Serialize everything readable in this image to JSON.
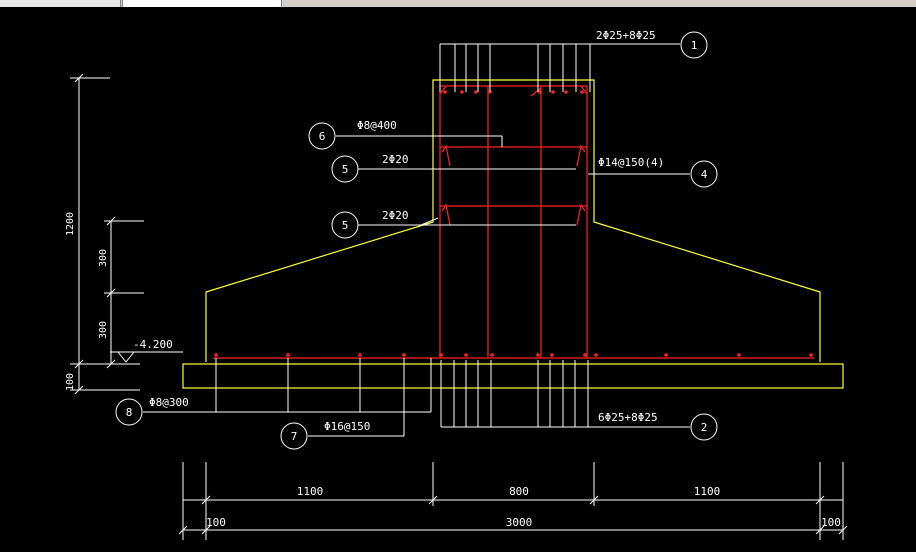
{
  "window": {
    "title": ""
  },
  "drawing": {
    "labels": {
      "top_bars": "2Φ25+8Φ25",
      "bottom_bars": "6Φ25+8Φ25",
      "tie_bar": "Φ8@400",
      "waist_bars_upper": "2Φ20",
      "waist_bars_lower": "2Φ20",
      "stirrup": "Φ14@150(4)",
      "mesh_y": "Φ16@150",
      "mesh_x": "Φ8@300",
      "elevation": "-4.200"
    },
    "callouts": {
      "c1": "1",
      "c2": "2",
      "c4": "4",
      "c5a": "5",
      "c5b": "5",
      "c6": "6",
      "c7": "7",
      "c8": "8"
    },
    "dimensions": {
      "left_height": "1200",
      "left_upper": "300",
      "left_lower": "300",
      "left_base": "100",
      "bottom_left": "1100",
      "bottom_mid": "800",
      "bottom_right": "1100",
      "bottom_total": "3000",
      "bottom_edge_left": "100",
      "bottom_edge_right": "100"
    },
    "colors": {
      "outline": "#ffff33",
      "rebar": "#ff2222",
      "annotation": "#ffffff",
      "background": "#000000"
    }
  }
}
